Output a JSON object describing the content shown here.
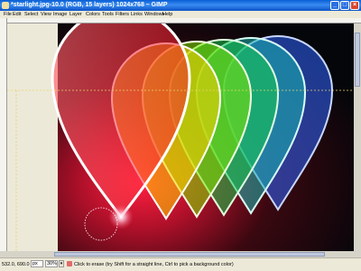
{
  "window": {
    "title": "*starlight.jpg-10.0 (RGB, 15 layers) 1024x768 – GIMP",
    "buttons": {
      "minimize": "_",
      "maximize": "□",
      "close": "×"
    }
  },
  "menubar": {
    "items": [
      "File",
      "Edit",
      "Select",
      "View",
      "Image",
      "Layer",
      "Colors",
      "Tools",
      "Filters",
      "Links",
      "Windows",
      "Help"
    ]
  },
  "status": {
    "coords": "532.0, 690.0",
    "unit": "px",
    "zoom": "30%",
    "hint": "Click to erase (try Shift for a straight line, Ctrl to pick a background color)"
  },
  "canvas": {
    "shape_colors": [
      "#ff1a2a",
      "#ffd200",
      "#7fe600",
      "#16c94a",
      "#18b7b0",
      "#2f64ff"
    ]
  }
}
